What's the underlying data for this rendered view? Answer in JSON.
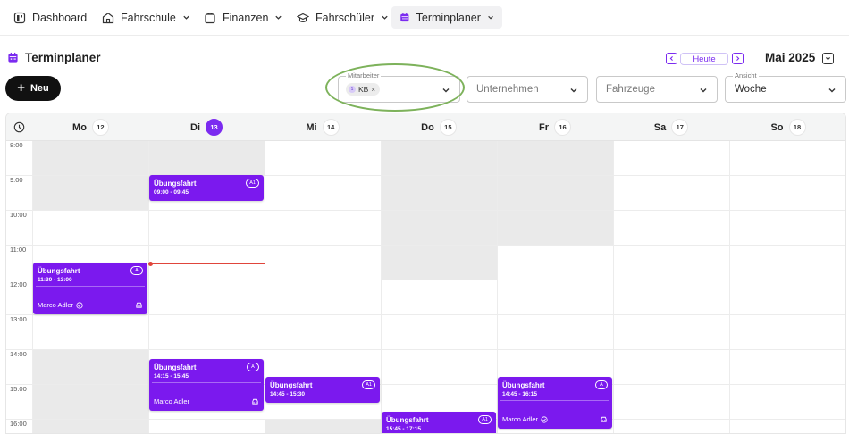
{
  "nav": {
    "items": [
      {
        "label": "Dashboard",
        "icon": "dashboard-icon"
      },
      {
        "label": "Fahrschule",
        "icon": "school-icon"
      },
      {
        "label": "Finanzen",
        "icon": "wallet-icon"
      },
      {
        "label": "Fahrschüler",
        "icon": "graduation-cap-icon"
      },
      {
        "label": "Terminplaner",
        "icon": "calendar-icon",
        "active": true
      }
    ]
  },
  "header": {
    "title": "Terminplaner",
    "new_label": "Neu",
    "today_label": "Heute",
    "month_label": "Mai 2025"
  },
  "filters": {
    "mitarbeiter": {
      "label": "Mitarbeiter",
      "chip": "KB",
      "chip_avatar": "1"
    },
    "unternehmen": {
      "placeholder": "Unternehmen"
    },
    "fahrzeuge": {
      "placeholder": "Fahrzeuge"
    },
    "ansicht": {
      "label": "Ansicht",
      "value": "Woche"
    }
  },
  "calendar": {
    "days": [
      {
        "name": "Mo",
        "num": "12"
      },
      {
        "name": "Di",
        "num": "13",
        "today": true
      },
      {
        "name": "Mi",
        "num": "14"
      },
      {
        "name": "Do",
        "num": "15"
      },
      {
        "name": "Fr",
        "num": "16"
      },
      {
        "name": "Sa",
        "num": "17"
      },
      {
        "name": "So",
        "num": "18"
      }
    ],
    "hours": [
      "8:00",
      "9:00",
      "10:00",
      "11:00",
      "12:00",
      "13:00",
      "14:00",
      "15:00",
      "16:00"
    ],
    "events": [
      {
        "title": "Übungsfahrt",
        "time": "09:00 - 09:45",
        "badge": "A1"
      },
      {
        "title": "Übungsfahrt",
        "time": "11:30 - 13:00",
        "badge": "A",
        "person": "Marco Adler",
        "verified": true
      },
      {
        "title": "Übungsfahrt",
        "time": "14:15 - 15:45",
        "badge": "A",
        "person": "Marco Adler"
      },
      {
        "title": "Übungsfahrt",
        "time": "14:45 - 15:30",
        "badge": "A1"
      },
      {
        "title": "Übungsfahrt",
        "time": "14:45 - 16:15",
        "badge": "A",
        "person": "Marco Adler",
        "verified": true
      },
      {
        "title": "Übungsfahrt",
        "time": "15:45 - 17:15",
        "badge": "A1"
      }
    ]
  },
  "colors": {
    "accent": "#7b19ee",
    "now_line": "#e0453b",
    "blocked": "#eaeaea",
    "highlight_ring": "#7db25b"
  }
}
